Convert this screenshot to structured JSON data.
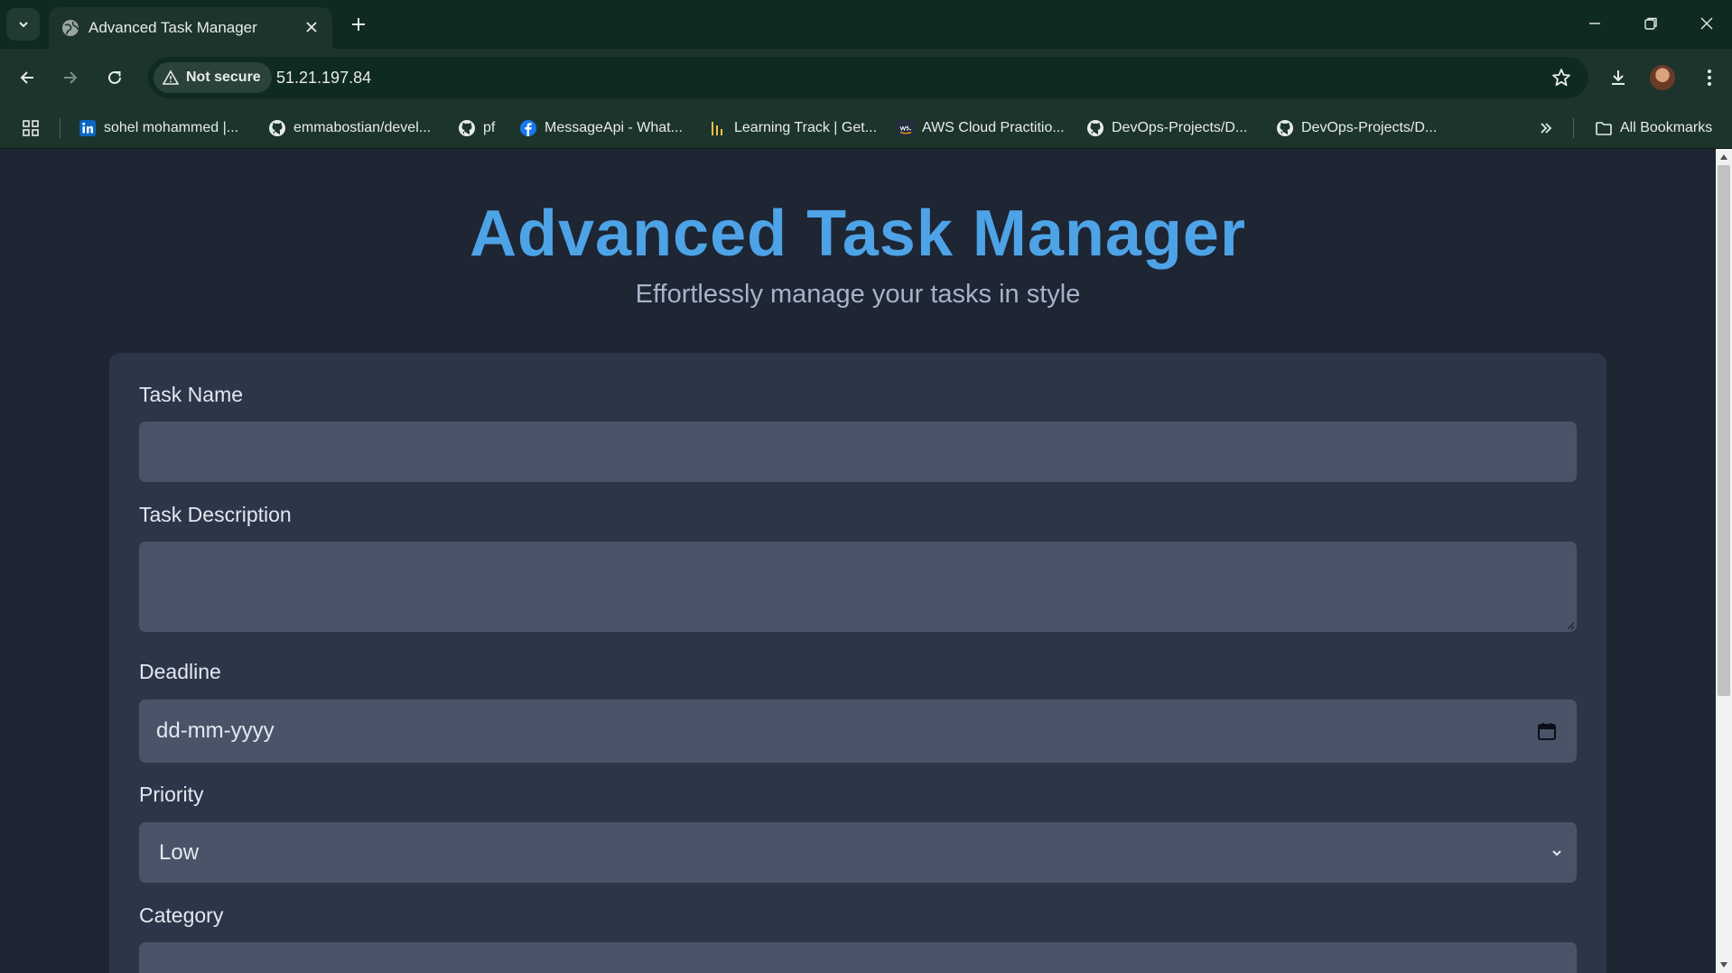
{
  "browser": {
    "tab_title": "Advanced Task Manager",
    "security_label": "Not secure",
    "url": "51.21.197.84",
    "bookmarks": [
      {
        "label": "sohel mohammed |...",
        "icon": "linkedin-icon"
      },
      {
        "label": "emmabostian/devel...",
        "icon": "github-icon"
      },
      {
        "label": "pf",
        "icon": "github-icon"
      },
      {
        "label": "MessageApi - What...",
        "icon": "facebook-icon"
      },
      {
        "label": "Learning Track | Get...",
        "icon": "learning-track-icon"
      },
      {
        "label": "AWS Cloud Practitio...",
        "icon": "aws-icon"
      },
      {
        "label": "DevOps-Projects/D...",
        "icon": "github-icon"
      },
      {
        "label": "DevOps-Projects/D...",
        "icon": "github-icon"
      }
    ],
    "all_bookmarks_label": "All Bookmarks"
  },
  "page": {
    "title": "Advanced Task Manager",
    "subtitle": "Effortlessly manage your tasks in style",
    "form": {
      "task_name_label": "Task Name",
      "task_name_value": "",
      "task_description_label": "Task Description",
      "task_description_value": "",
      "deadline_label": "Deadline",
      "deadline_placeholder": "dd-mm-yyyy",
      "priority_label": "Priority",
      "priority_selected": "Low",
      "category_label": "Category"
    }
  },
  "colors": {
    "page_bg": "#1e2533",
    "card_bg": "#2d3648",
    "field_bg": "#4a5468",
    "title_accent": "#4da3e6",
    "chrome_bg": "#1d342d"
  }
}
